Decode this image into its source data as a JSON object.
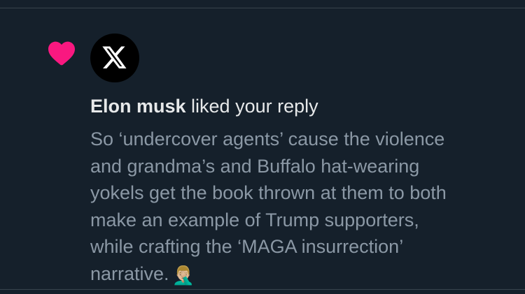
{
  "notification": {
    "user_name": "Elon musk",
    "action_text": " liked your reply",
    "reply_lines": [
      "So ‘undercover agents’ cause the violence",
      "and grandma’s and Buffalo hat-wearing",
      "yokels get the book thrown at them to both",
      "make an example of Trump supporters,",
      "while crafting the ‘MAGA insurrection’",
      "narrative."
    ],
    "reply_emoji": "🤦🏼‍♂️",
    "icon": "heart-icon",
    "avatar_icon": "x-logo-icon"
  },
  "colors": {
    "background": "#15202b",
    "heart": "#f91880",
    "primary_text": "#e7e9ea",
    "secondary_text": "#8b98a5",
    "divider": "#38444d"
  }
}
